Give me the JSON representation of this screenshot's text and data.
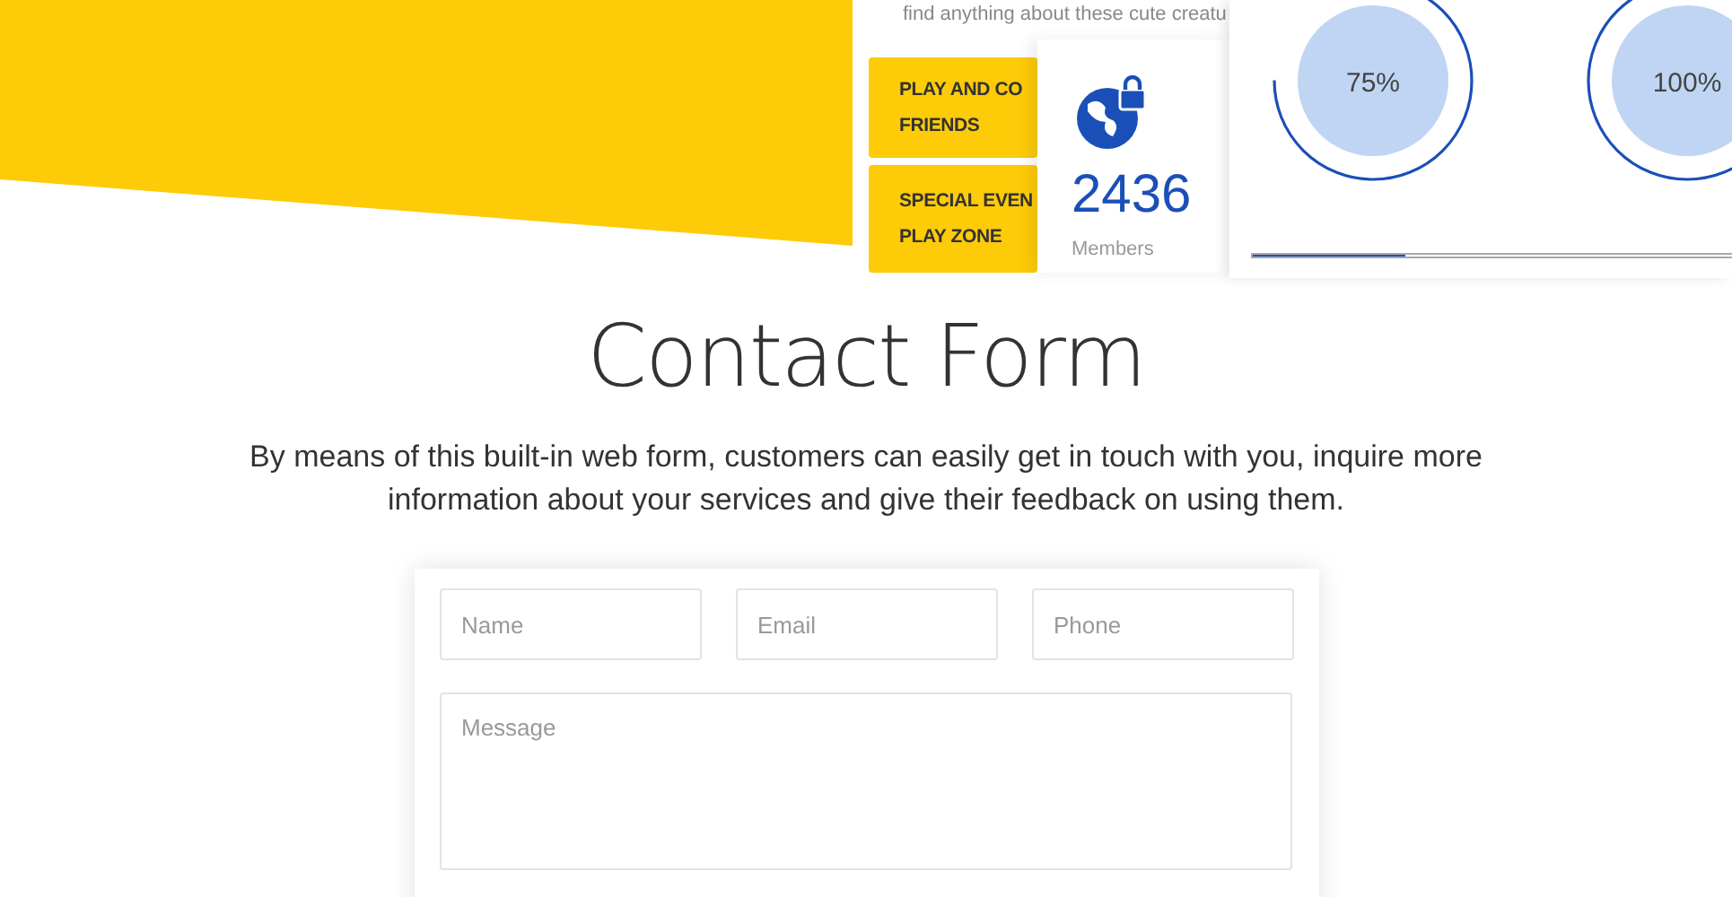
{
  "hero": {
    "intro_text": "find anything about these cute creatu",
    "menu_buttons": [
      {
        "lines": [
          "PLAY AND CO",
          "FRIENDS"
        ]
      },
      {
        "lines": [
          "SPECIAL EVEN",
          "PLAY ZONE"
        ]
      }
    ],
    "stat": {
      "value": "2436",
      "label": "Members"
    },
    "rings": [
      {
        "label": "75%",
        "level": 0.75
      },
      {
        "label": "100%"
      }
    ],
    "progress": {
      "level": 0.32
    }
  },
  "contact": {
    "title": "Contact Form",
    "description": "By means of this built-in web form, customers can easily get in touch with you, inquire more information about your services and give their feedback on using them.",
    "fields": [
      {
        "placeholder": "Name"
      },
      {
        "placeholder": "Email"
      },
      {
        "placeholder": "Phone"
      }
    ],
    "message": {
      "placeholder": "Message"
    }
  }
}
